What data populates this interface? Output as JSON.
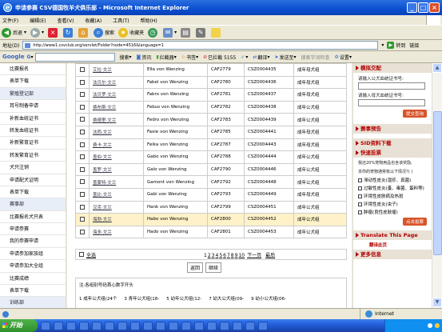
{
  "window": {
    "title": "申请参赛 CSV德国牧羊犬俱乐部 - Microsoft Internet Explorer"
  },
  "menu": [
    "文件(F)",
    "编辑(E)",
    "查看(V)",
    "收藏(A)",
    "工具(T)",
    "帮助(H)"
  ],
  "toolbar": {
    "back": "后退",
    "search": "搜索",
    "favorites": "收藏夹"
  },
  "address": {
    "label": "地址(D)",
    "url": "http://www1.csvclub.org/servlet/Folder?node=4516&language=1",
    "go": "转到",
    "links": "链接"
  },
  "google": {
    "logo": "Google",
    "search_btn": "搜索",
    "news": "资讯",
    "pagerank": "拦截器",
    "bookmarks": "书签",
    "blocked": "已拦截 5155",
    "translate": "翻译",
    "send": "发送至",
    "settings": "设置",
    "spell": "搜索字词检查",
    "g_label": "G"
  },
  "sidebar": {
    "items": [
      {
        "label": "比赛报名",
        "section": false
      },
      {
        "label": "表单下载",
        "section": false
      },
      {
        "label": "繁殖登记部",
        "section": true
      },
      {
        "label": "耳号制备申请",
        "section": false
      },
      {
        "label": "补新血统证书",
        "section": false
      },
      {
        "label": "转发血统证书",
        "section": false
      },
      {
        "label": "补新繁育证书",
        "section": false
      },
      {
        "label": "转发繁育证书",
        "section": false
      },
      {
        "label": "犬只注销",
        "section": false
      },
      {
        "label": "申请配犬证明",
        "section": false
      },
      {
        "label": "表单下载",
        "section": false
      },
      {
        "label": "赛事部",
        "section": true
      },
      {
        "label": "比赛报名犬只表",
        "section": false
      },
      {
        "label": "申请参赛",
        "section": false
      },
      {
        "label": "我的参赛申请",
        "section": false
      },
      {
        "label": "申请参加家族组",
        "section": false
      },
      {
        "label": "申请参加大全组",
        "section": false
      },
      {
        "label": "比赛成绩",
        "section": false
      },
      {
        "label": "表单下载",
        "section": false
      },
      {
        "label": "训练部",
        "section": true
      }
    ]
  },
  "table": {
    "rows": [
      {
        "name": "艾拉·文兰",
        "en": "Ella von Wenzing",
        "id": "CAF2779",
        "code": "CSZ0004435",
        "group": "成年母犬组",
        "hl": false
      },
      {
        "name": "法贝尔·文兰",
        "en": "Fabel von Wenzing",
        "id": "CAF2780",
        "code": "CSZ0004436",
        "group": "成年母犬组",
        "hl": false
      },
      {
        "name": "法贝罗·文兰",
        "en": "Fabro von Wenzing",
        "id": "CAF2781",
        "code": "CSZ0004437",
        "group": "成年母犬组",
        "hl": false
      },
      {
        "name": "费布斯·文兰",
        "en": "Febus von Wenzing",
        "id": "CAF2782",
        "code": "CSZ0004438",
        "group": "成年公犬组",
        "hl": false
      },
      {
        "name": "费德里·文兰",
        "en": "Fedro von Wenzing",
        "id": "CAF2783",
        "code": "CSZ0004439",
        "group": "成年公犬组",
        "hl": false
      },
      {
        "name": "法西·文兰",
        "en": "Faxie von Wenzing",
        "id": "CAF2785",
        "code": "CSZ0004441",
        "group": "成年母犬组",
        "hl": false
      },
      {
        "name": "费卡·文兰",
        "en": "Feika von Wenzing",
        "id": "CAF2787",
        "code": "CSZ0004443",
        "group": "成年母犬组",
        "hl": false
      },
      {
        "name": "盖伯·文兰",
        "en": "Gabo von Wenzing",
        "id": "CAF2788",
        "code": "CSZ0004444",
        "group": "成年公犬组",
        "hl": false
      },
      {
        "name": "盖罗·文兰",
        "en": "Galo von Wenzing",
        "id": "CAF2790",
        "code": "CSZ0004446",
        "group": "成年公犬组",
        "hl": false
      },
      {
        "name": "盖蒙特·文兰",
        "en": "Gamont von Wenzing",
        "id": "CAF2792",
        "code": "CSZ0004448",
        "group": "成年公犬组",
        "hl": false
      },
      {
        "name": "盖比·文兰",
        "en": "Gabi von Wenzing",
        "id": "CAF2793",
        "code": "CSZ0004449",
        "group": "成年母犬组",
        "hl": false
      },
      {
        "name": "汉克·文兰",
        "en": "Hank von Wenzing",
        "id": "CAF2799",
        "code": "CSZ0004451",
        "group": "成年公犬组",
        "hl": false
      },
      {
        "name": "海勃·文兰",
        "en": "Habo von Wenzing",
        "id": "CAF2800",
        "code": "CSZ0004452",
        "group": "成年公犬组",
        "hl": true
      },
      {
        "name": "海多·文兰",
        "en": "Hado von Wenzing",
        "id": "CAF2801",
        "code": "CSZ0004453",
        "group": "成年公犬组",
        "hl": false
      }
    ],
    "select_all": "全选",
    "pages": [
      "1",
      "2",
      "3",
      "4",
      "5",
      "6",
      "7",
      "8",
      "9",
      "10"
    ],
    "next": "下一页",
    "last": "最后"
  },
  "buttons": {
    "back": "返回",
    "continue": "继续"
  },
  "note": {
    "title": "注:各组别号码首心数字开头",
    "cols": [
      "1 成年公犬组(24个",
      "3 青年公犬组(18-",
      "5 幼年公犬组(12-",
      "7 幼大公犬组(09-",
      "9 幼小公犬组(06-"
    ]
  },
  "right": {
    "query_head": "模拟交配",
    "sire_label": "请输入公犬血统证书号:",
    "dam_label": "请输入母犬血统证书号:",
    "submit": "提交查询",
    "schedule_head": "赛事预告",
    "sid_head": "SID资料下载",
    "vote_head": "快速投票",
    "vote_intro": "我还20%宠物用品也含该奖励,",
    "vote_q": "本你的宠物通常有以下情况?( )",
    "vote_opts": [
      "滞动性皮炎(湿疹、真菌)",
      "过敏性皮炎(蚤、毒菌、蛋料等)",
      "环境性皮肤病及热斑",
      "环境性皮炎(虫子)",
      "肿瘤(良性皮肤瘤)"
    ],
    "vote_btn": "点击投票",
    "translate": "Translate This Page",
    "translate_sub": "翻译此页",
    "more": "更多信息"
  },
  "status": {
    "zone": "Internet"
  },
  "taskbar": {
    "start": "开始"
  }
}
